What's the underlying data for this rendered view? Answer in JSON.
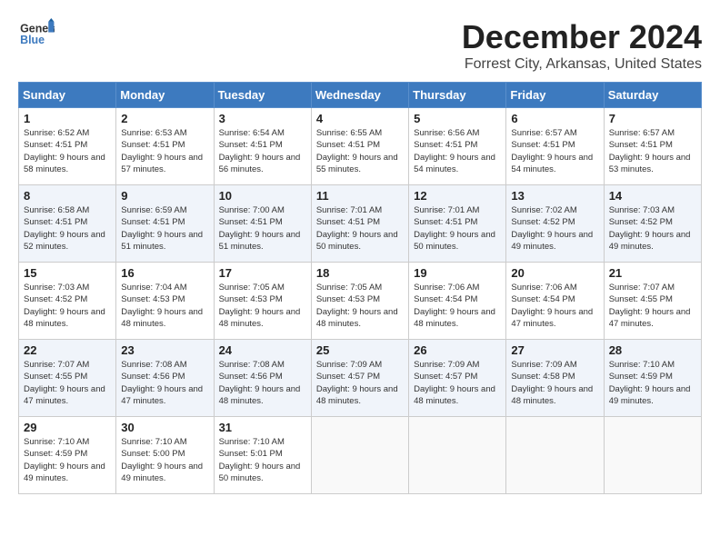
{
  "logo": {
    "line1": "General",
    "line2": "Blue"
  },
  "title": "December 2024",
  "location": "Forrest City, Arkansas, United States",
  "days_of_week": [
    "Sunday",
    "Monday",
    "Tuesday",
    "Wednesday",
    "Thursday",
    "Friday",
    "Saturday"
  ],
  "weeks": [
    [
      {
        "day": "1",
        "sunrise": "Sunrise: 6:52 AM",
        "sunset": "Sunset: 4:51 PM",
        "daylight": "Daylight: 9 hours and 58 minutes."
      },
      {
        "day": "2",
        "sunrise": "Sunrise: 6:53 AM",
        "sunset": "Sunset: 4:51 PM",
        "daylight": "Daylight: 9 hours and 57 minutes."
      },
      {
        "day": "3",
        "sunrise": "Sunrise: 6:54 AM",
        "sunset": "Sunset: 4:51 PM",
        "daylight": "Daylight: 9 hours and 56 minutes."
      },
      {
        "day": "4",
        "sunrise": "Sunrise: 6:55 AM",
        "sunset": "Sunset: 4:51 PM",
        "daylight": "Daylight: 9 hours and 55 minutes."
      },
      {
        "day": "5",
        "sunrise": "Sunrise: 6:56 AM",
        "sunset": "Sunset: 4:51 PM",
        "daylight": "Daylight: 9 hours and 54 minutes."
      },
      {
        "day": "6",
        "sunrise": "Sunrise: 6:57 AM",
        "sunset": "Sunset: 4:51 PM",
        "daylight": "Daylight: 9 hours and 54 minutes."
      },
      {
        "day": "7",
        "sunrise": "Sunrise: 6:57 AM",
        "sunset": "Sunset: 4:51 PM",
        "daylight": "Daylight: 9 hours and 53 minutes."
      }
    ],
    [
      {
        "day": "8",
        "sunrise": "Sunrise: 6:58 AM",
        "sunset": "Sunset: 4:51 PM",
        "daylight": "Daylight: 9 hours and 52 minutes."
      },
      {
        "day": "9",
        "sunrise": "Sunrise: 6:59 AM",
        "sunset": "Sunset: 4:51 PM",
        "daylight": "Daylight: 9 hours and 51 minutes."
      },
      {
        "day": "10",
        "sunrise": "Sunrise: 7:00 AM",
        "sunset": "Sunset: 4:51 PM",
        "daylight": "Daylight: 9 hours and 51 minutes."
      },
      {
        "day": "11",
        "sunrise": "Sunrise: 7:01 AM",
        "sunset": "Sunset: 4:51 PM",
        "daylight": "Daylight: 9 hours and 50 minutes."
      },
      {
        "day": "12",
        "sunrise": "Sunrise: 7:01 AM",
        "sunset": "Sunset: 4:51 PM",
        "daylight": "Daylight: 9 hours and 50 minutes."
      },
      {
        "day": "13",
        "sunrise": "Sunrise: 7:02 AM",
        "sunset": "Sunset: 4:52 PM",
        "daylight": "Daylight: 9 hours and 49 minutes."
      },
      {
        "day": "14",
        "sunrise": "Sunrise: 7:03 AM",
        "sunset": "Sunset: 4:52 PM",
        "daylight": "Daylight: 9 hours and 49 minutes."
      }
    ],
    [
      {
        "day": "15",
        "sunrise": "Sunrise: 7:03 AM",
        "sunset": "Sunset: 4:52 PM",
        "daylight": "Daylight: 9 hours and 48 minutes."
      },
      {
        "day": "16",
        "sunrise": "Sunrise: 7:04 AM",
        "sunset": "Sunset: 4:53 PM",
        "daylight": "Daylight: 9 hours and 48 minutes."
      },
      {
        "day": "17",
        "sunrise": "Sunrise: 7:05 AM",
        "sunset": "Sunset: 4:53 PM",
        "daylight": "Daylight: 9 hours and 48 minutes."
      },
      {
        "day": "18",
        "sunrise": "Sunrise: 7:05 AM",
        "sunset": "Sunset: 4:53 PM",
        "daylight": "Daylight: 9 hours and 48 minutes."
      },
      {
        "day": "19",
        "sunrise": "Sunrise: 7:06 AM",
        "sunset": "Sunset: 4:54 PM",
        "daylight": "Daylight: 9 hours and 48 minutes."
      },
      {
        "day": "20",
        "sunrise": "Sunrise: 7:06 AM",
        "sunset": "Sunset: 4:54 PM",
        "daylight": "Daylight: 9 hours and 47 minutes."
      },
      {
        "day": "21",
        "sunrise": "Sunrise: 7:07 AM",
        "sunset": "Sunset: 4:55 PM",
        "daylight": "Daylight: 9 hours and 47 minutes."
      }
    ],
    [
      {
        "day": "22",
        "sunrise": "Sunrise: 7:07 AM",
        "sunset": "Sunset: 4:55 PM",
        "daylight": "Daylight: 9 hours and 47 minutes."
      },
      {
        "day": "23",
        "sunrise": "Sunrise: 7:08 AM",
        "sunset": "Sunset: 4:56 PM",
        "daylight": "Daylight: 9 hours and 47 minutes."
      },
      {
        "day": "24",
        "sunrise": "Sunrise: 7:08 AM",
        "sunset": "Sunset: 4:56 PM",
        "daylight": "Daylight: 9 hours and 48 minutes."
      },
      {
        "day": "25",
        "sunrise": "Sunrise: 7:09 AM",
        "sunset": "Sunset: 4:57 PM",
        "daylight": "Daylight: 9 hours and 48 minutes."
      },
      {
        "day": "26",
        "sunrise": "Sunrise: 7:09 AM",
        "sunset": "Sunset: 4:57 PM",
        "daylight": "Daylight: 9 hours and 48 minutes."
      },
      {
        "day": "27",
        "sunrise": "Sunrise: 7:09 AM",
        "sunset": "Sunset: 4:58 PM",
        "daylight": "Daylight: 9 hours and 48 minutes."
      },
      {
        "day": "28",
        "sunrise": "Sunrise: 7:10 AM",
        "sunset": "Sunset: 4:59 PM",
        "daylight": "Daylight: 9 hours and 49 minutes."
      }
    ],
    [
      {
        "day": "29",
        "sunrise": "Sunrise: 7:10 AM",
        "sunset": "Sunset: 4:59 PM",
        "daylight": "Daylight: 9 hours and 49 minutes."
      },
      {
        "day": "30",
        "sunrise": "Sunrise: 7:10 AM",
        "sunset": "Sunset: 5:00 PM",
        "daylight": "Daylight: 9 hours and 49 minutes."
      },
      {
        "day": "31",
        "sunrise": "Sunrise: 7:10 AM",
        "sunset": "Sunset: 5:01 PM",
        "daylight": "Daylight: 9 hours and 50 minutes."
      },
      null,
      null,
      null,
      null
    ]
  ]
}
